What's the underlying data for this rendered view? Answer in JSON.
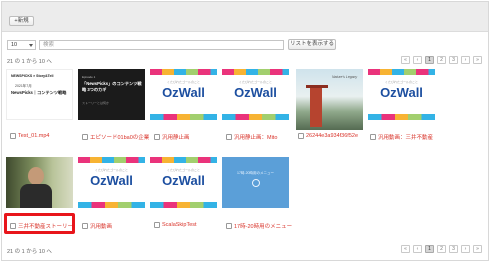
{
  "toolbar": {
    "new_label": "+新規"
  },
  "filter": {
    "per_page": "10",
    "search_placeholder": "検索",
    "list_button": "リストを表示する"
  },
  "count_text": "21 の 1 から 10 へ",
  "pagination": {
    "pages": [
      "«",
      "‹",
      "1",
      "2",
      "3",
      "›",
      "»"
    ],
    "active": "1"
  },
  "colors": {
    "caption": "#d9342b",
    "highlight": "#e8151b",
    "ozwall_blue": "#1d4fa0"
  },
  "thumbs": {
    "newspicks": {
      "brand": "NEWSPICKS × Story&Tell",
      "line1": "2021年7月",
      "line2": "NewsPicks｜コンテンツ戦略"
    },
    "episode": {
      "tag": "Episode 1",
      "title": "「NewsPicks」のコンテンツ戦略 3つのカギ",
      "footer": "ストーリーとは何か"
    },
    "ozwall": {
      "logo": "OzWall",
      "sub": "くたびれたゴールのこと"
    },
    "photo_title": "Nature's Legacy",
    "slide_text": "17時-20時用のメニュー"
  },
  "items": [
    {
      "caption": "Test_01.mp4"
    },
    {
      "caption": "エピソード01ba0の企業"
    },
    {
      "caption": "汎用静止画"
    },
    {
      "caption": "汎用静止画：Mito"
    },
    {
      "caption": "26244e3a934f36f52e"
    },
    {
      "caption": "汎用動画：三井不動産"
    },
    {
      "caption": "三井不動産ストーリー"
    },
    {
      "caption": "汎用動画"
    },
    {
      "caption": "ScalaSkipTest"
    },
    {
      "caption": "17時-20時用のメニュー"
    }
  ]
}
